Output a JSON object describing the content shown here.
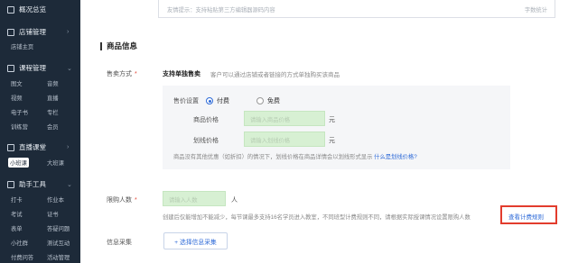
{
  "sidebar": {
    "overview": "概况总览",
    "store_mgmt": "店铺管理",
    "store_sub": [
      "店铺主页"
    ],
    "course_mgmt": "课程管理",
    "course_sub": [
      [
        "图文",
        "音频"
      ],
      [
        "视频",
        "直播"
      ],
      [
        "电子书",
        "专栏"
      ],
      [
        "训练营",
        "会员"
      ]
    ],
    "live": "直播课堂",
    "live_sub": [
      "小班课",
      "大班课"
    ],
    "tools": "助手工具",
    "tools_sub": [
      [
        "打卡",
        "作业本"
      ],
      [
        "考试",
        "证书"
      ],
      [
        "表单",
        "答疑问题"
      ],
      [
        "小社群",
        "测试互动"
      ],
      [
        "付费问答",
        "活动管理"
      ]
    ]
  },
  "top": {
    "placeholder": "友情提示：支持粘贴第三方编辑器源码内容",
    "count": "字数统计"
  },
  "section": {
    "title": "商品信息"
  },
  "sale": {
    "label": "售卖方式",
    "req": "*",
    "mode": "支持单独售卖",
    "desc": "客户可以通过店铺或者链接的方式单独购买该商品"
  },
  "price": {
    "label": "售价设置",
    "paid": "付费",
    "free": "免费",
    "goods_price_label": "商品价格",
    "goods_price_ph": "请输入商品价格",
    "strike_price_label": "划线价格",
    "strike_price_ph": "请输入划线价格",
    "unit": "元",
    "note": "商品没有其他优惠（如折扣）的情况下，划线价格在商品详情会以划线形式显示",
    "note_link": "什么是划线价格?"
  },
  "limit": {
    "label": "限购人数",
    "req": "*",
    "ph": "请输入人数",
    "unit": "人",
    "note": "创建后仅能增加不能减少，每节课最多支持16名学员进入教室，不同班型计费规则不同，请根据实际授课情况设置限购人数",
    "rule_link": "查看计费规则"
  },
  "collect": {
    "label": "信息采集",
    "button": "+ 选择信息采集"
  }
}
